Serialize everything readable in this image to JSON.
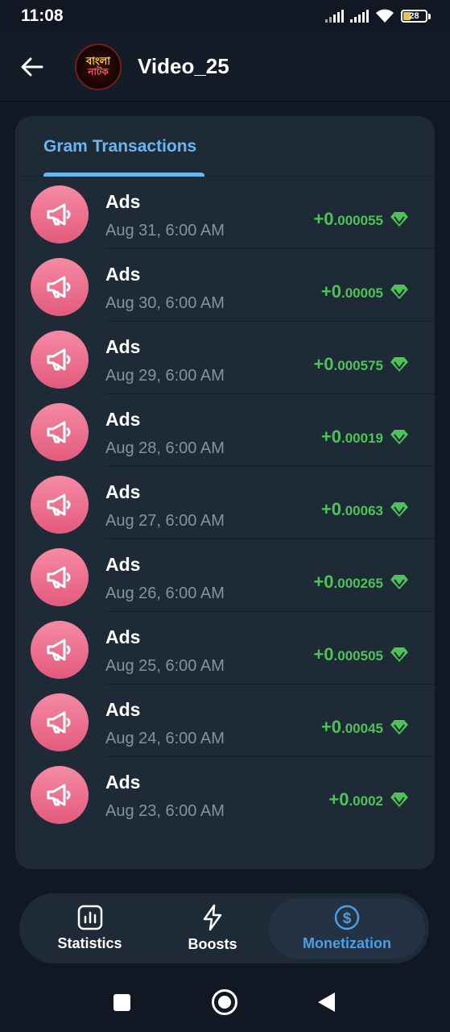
{
  "status_bar": {
    "time": "11:08",
    "battery": "28",
    "icons": [
      "signal-icon",
      "signal-icon",
      "wifi-icon",
      "battery-icon"
    ]
  },
  "header": {
    "title": "Video_25",
    "avatar_text_line1": "বাংলা",
    "avatar_text_line2": "নাটক",
    "back_icon": "arrow-left-icon"
  },
  "tabs": {
    "active": "Gram Transactions"
  },
  "transactions": [
    {
      "title": "Ads",
      "date": "Aug 31, 6:00 AM",
      "amount_int": "+0",
      "amount_dec": ".000055"
    },
    {
      "title": "Ads",
      "date": "Aug 30, 6:00 AM",
      "amount_int": "+0",
      "amount_dec": ".00005"
    },
    {
      "title": "Ads",
      "date": "Aug 29, 6:00 AM",
      "amount_int": "+0",
      "amount_dec": ".000575"
    },
    {
      "title": "Ads",
      "date": "Aug 28, 6:00 AM",
      "amount_int": "+0",
      "amount_dec": ".00019"
    },
    {
      "title": "Ads",
      "date": "Aug 27, 6:00 AM",
      "amount_int": "+0",
      "amount_dec": ".00063"
    },
    {
      "title": "Ads",
      "date": "Aug 26, 6:00 AM",
      "amount_int": "+0",
      "amount_dec": ".000265"
    },
    {
      "title": "Ads",
      "date": "Aug 25, 6:00 AM",
      "amount_int": "+0",
      "amount_dec": ".000505"
    },
    {
      "title": "Ads",
      "date": "Aug 24, 6:00 AM",
      "amount_int": "+0",
      "amount_dec": ".00045"
    },
    {
      "title": "Ads",
      "date": "Aug 23, 6:00 AM",
      "amount_int": "+0",
      "amount_dec": ".0002"
    }
  ],
  "bottom_nav": {
    "statistics": "Statistics",
    "boosts": "Boosts",
    "monetization": "Monetization"
  },
  "colors": {
    "background": "#111823",
    "card": "#1f2a37",
    "accent": "#69b6f1",
    "amount_green": "#4fc25a",
    "ads_icon_pink": "#ec6f8f",
    "active_nav": "#4a9fe6"
  }
}
